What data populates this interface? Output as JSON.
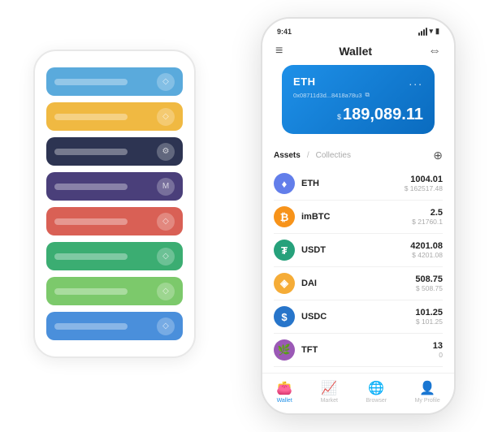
{
  "scene": {
    "bg_phone": {
      "rows": [
        {
          "color": "#5AAADC",
          "icon": "◇"
        },
        {
          "color": "#F0B942",
          "icon": "◇"
        },
        {
          "color": "#2D3452",
          "icon": "⚙"
        },
        {
          "color": "#4A3F7A",
          "icon": "M"
        },
        {
          "color": "#D96055",
          "icon": "◇"
        },
        {
          "color": "#3BAD72",
          "icon": "◇"
        },
        {
          "color": "#7CC96B",
          "icon": "◇"
        },
        {
          "color": "#4A8FDB",
          "icon": "◇"
        }
      ]
    },
    "main_phone": {
      "status_bar": {
        "time": "9:41",
        "signal": "|||",
        "wifi": "▾",
        "battery": "▮"
      },
      "nav": {
        "menu_icon": "≡",
        "title": "Wallet",
        "expand_icon": "⇔"
      },
      "eth_card": {
        "label": "ETH",
        "dots": "...",
        "address": "0x08711d3d...8418a78u3",
        "copy_icon": "⧉",
        "balance_prefix": "$",
        "balance": "189,089.11"
      },
      "assets_header": {
        "tab_active": "Assets",
        "separator": "/",
        "tab_inactive": "Collecties",
        "add_icon": "⊕"
      },
      "assets": [
        {
          "name": "ETH",
          "icon_bg": "#627EEA",
          "icon_text": "♦",
          "icon_color": "#fff",
          "amount": "1004.01",
          "usd": "$ 162517.48"
        },
        {
          "name": "imBTC",
          "icon_bg": "#F7931A",
          "icon_text": "₿",
          "icon_color": "#fff",
          "amount": "2.5",
          "usd": "$ 21760.1"
        },
        {
          "name": "USDT",
          "icon_bg": "#26A17B",
          "icon_text": "₮",
          "icon_color": "#fff",
          "amount": "4201.08",
          "usd": "$ 4201.08"
        },
        {
          "name": "DAI",
          "icon_bg": "#F5AC37",
          "icon_text": "◈",
          "icon_color": "#fff",
          "amount": "508.75",
          "usd": "$ 508.75"
        },
        {
          "name": "USDC",
          "icon_bg": "#2775CA",
          "icon_text": "$",
          "icon_color": "#fff",
          "amount": "101.25",
          "usd": "$ 101.25"
        },
        {
          "name": "TFT",
          "icon_bg": "#9B59B6",
          "icon_text": "🌿",
          "icon_color": "#fff",
          "amount": "13",
          "usd": "0"
        }
      ],
      "bottom_nav": [
        {
          "icon": "👛",
          "label": "Wallet",
          "active": true
        },
        {
          "icon": "📈",
          "label": "Market",
          "active": false
        },
        {
          "icon": "🌐",
          "label": "Browser",
          "active": false
        },
        {
          "icon": "👤",
          "label": "My Profile",
          "active": false
        }
      ]
    }
  }
}
